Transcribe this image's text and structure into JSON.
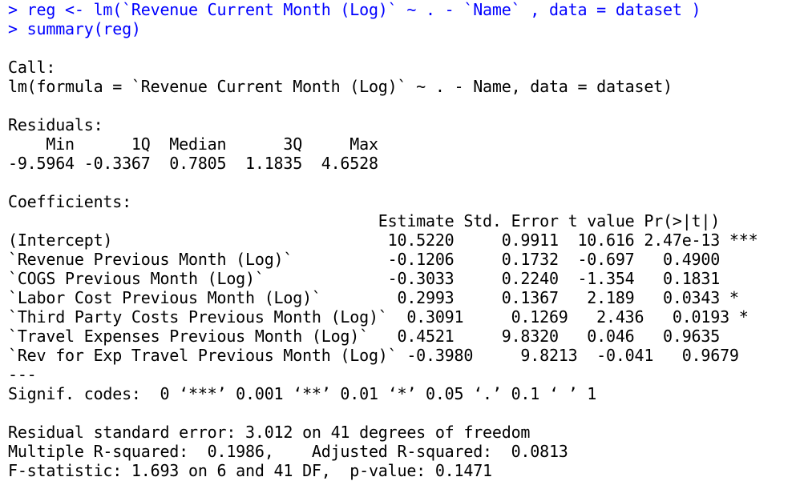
{
  "console": {
    "lines": [
      {
        "kind": "input",
        "text": "> reg <- lm(`Revenue Current Month (Log)` ~ . - `Name` , data = dataset )"
      },
      {
        "kind": "input",
        "text": "> summary(reg)"
      },
      {
        "kind": "output",
        "text": ""
      },
      {
        "kind": "output",
        "text": "Call:"
      },
      {
        "kind": "output",
        "text": "lm(formula = `Revenue Current Month (Log)` ~ . - Name, data = dataset)"
      },
      {
        "kind": "output",
        "text": ""
      },
      {
        "kind": "output",
        "text": "Residuals:"
      },
      {
        "kind": "output",
        "text": "    Min      1Q  Median      3Q     Max "
      },
      {
        "kind": "output",
        "text": "-9.5964 -0.3367  0.7805  1.1835  4.6528 "
      },
      {
        "kind": "output",
        "text": ""
      },
      {
        "kind": "output",
        "text": "Coefficients:"
      },
      {
        "kind": "output",
        "text": "                                       Estimate Std. Error t value Pr(>|t|)    "
      },
      {
        "kind": "output",
        "text": "(Intercept)                             10.5220     0.9911  10.616 2.47e-13 ***"
      },
      {
        "kind": "output",
        "text": "`Revenue Previous Month (Log)`          -0.1206     0.1732  -0.697   0.4900    "
      },
      {
        "kind": "output",
        "text": "`COGS Previous Month (Log)`             -0.3033     0.2240  -1.354   0.1831    "
      },
      {
        "kind": "output",
        "text": "`Labor Cost Previous Month (Log)`        0.2993     0.1367   2.189   0.0343 *  "
      },
      {
        "kind": "output",
        "text": "`Third Party Costs Previous Month (Log)`  0.3091     0.1269   2.436   0.0193 *  "
      },
      {
        "kind": "output",
        "text": "`Travel Expenses Previous Month (Log)`   0.4521     9.8320   0.046   0.9635    "
      },
      {
        "kind": "output",
        "text": "`Rev for Exp Travel Previous Month (Log)` -0.3980     9.8213  -0.041   0.9679    "
      },
      {
        "kind": "output",
        "text": "---"
      },
      {
        "kind": "output",
        "text": "Signif. codes:  0 ‘***’ 0.001 ‘**’ 0.01 ‘*’ 0.05 ‘.’ 0.1 ‘ ’ 1"
      },
      {
        "kind": "output",
        "text": ""
      },
      {
        "kind": "output",
        "text": "Residual standard error: 3.012 on 41 degrees of freedom"
      },
      {
        "kind": "output",
        "text": "Multiple R-squared:  0.1986,    Adjusted R-squared:  0.0813 "
      },
      {
        "kind": "output",
        "text": "F-statistic: 1.693 on 6 and 41 DF,  p-value: 0.1471"
      }
    ]
  },
  "colors": {
    "input_text": "#0000ff",
    "output_text": "#000000",
    "background": "#ffffff"
  }
}
